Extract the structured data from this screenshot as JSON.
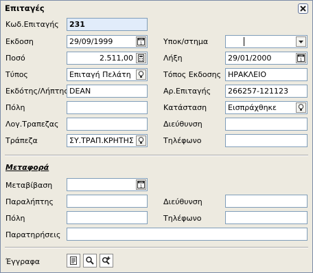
{
  "window": {
    "title": "Επιταγές"
  },
  "fields": {
    "code": {
      "label": "Κωδ.Επιταγής",
      "value": "231"
    },
    "issue_date": {
      "label": "Εκδοση",
      "value": "29/09/1999"
    },
    "amount": {
      "label": "Ποσό",
      "value": "2.511,00"
    },
    "type": {
      "label": "Τύπος",
      "value": "Επιταγή Πελάτη"
    },
    "issuer": {
      "label": "Εκδότης/Λήπτης",
      "value": "DEAN"
    },
    "city": {
      "label": "Πόλη",
      "value": ""
    },
    "bank_account": {
      "label": "Λογ.Τραπεζας",
      "value": ""
    },
    "bank": {
      "label": "Τράπεζα",
      "value": "ΣΥ.ΤΡΑΠ.ΚΡΗΤΗΣ"
    },
    "subaccount": {
      "label": "Υποκ/στημα",
      "value": ""
    },
    "due_date": {
      "label": "Λήξη",
      "value": "29/01/2000"
    },
    "issue_place": {
      "label": "Τόπος Εκδοσης",
      "value": "ΗΡΑΚΛΕΙΟ"
    },
    "check_number": {
      "label": "Αρ.Επιταγής",
      "value": "266257-121123"
    },
    "status": {
      "label": "Κατάσταση",
      "value": "Εισπράχθηκε"
    },
    "address": {
      "label": "Διεύθυνση",
      "value": ""
    },
    "phone": {
      "label": "Τηλέφωνο",
      "value": ""
    }
  },
  "transfer": {
    "section_title": "Μεταφορά",
    "transfer_date": {
      "label": "Μεταβίβαση",
      "value": ""
    },
    "recipient": {
      "label": "Παραλήπτης",
      "value": ""
    },
    "address": {
      "label": "Διεύθυνση",
      "value": ""
    },
    "city": {
      "label": "Πόλη",
      "value": ""
    },
    "phone": {
      "label": "Τηλέφωνο",
      "value": ""
    },
    "notes": {
      "label": "Παρατηρήσεις",
      "value": ""
    }
  },
  "documents": {
    "label": "Έγγραφα"
  },
  "calendar_icon_text": {
    "top": "JAN",
    "day": "1"
  }
}
